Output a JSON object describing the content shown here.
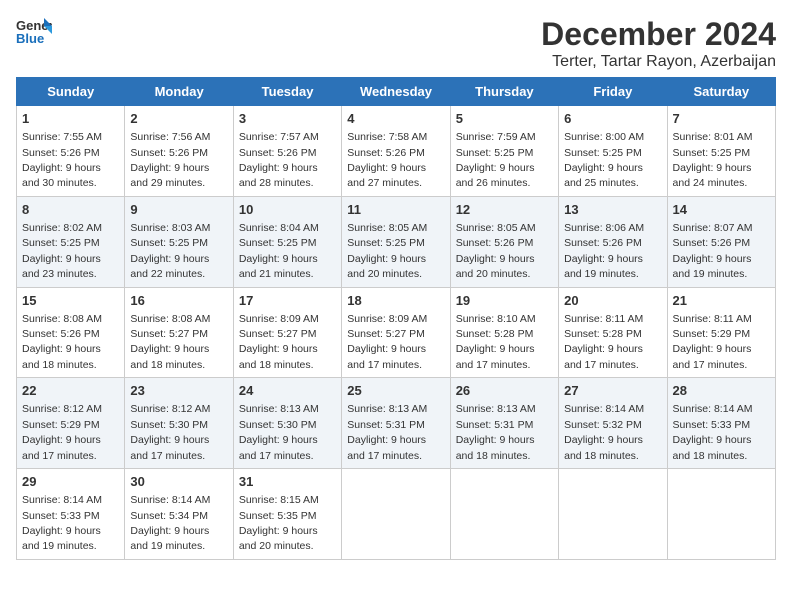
{
  "header": {
    "logo_line1": "General",
    "logo_line2": "Blue",
    "main_title": "December 2024",
    "subtitle": "Terter, Tartar Rayon, Azerbaijan"
  },
  "weekdays": [
    "Sunday",
    "Monday",
    "Tuesday",
    "Wednesday",
    "Thursday",
    "Friday",
    "Saturday"
  ],
  "weeks": [
    [
      {
        "day": "1",
        "info": "Sunrise: 7:55 AM\nSunset: 5:26 PM\nDaylight: 9 hours\nand 30 minutes."
      },
      {
        "day": "2",
        "info": "Sunrise: 7:56 AM\nSunset: 5:26 PM\nDaylight: 9 hours\nand 29 minutes."
      },
      {
        "day": "3",
        "info": "Sunrise: 7:57 AM\nSunset: 5:26 PM\nDaylight: 9 hours\nand 28 minutes."
      },
      {
        "day": "4",
        "info": "Sunrise: 7:58 AM\nSunset: 5:26 PM\nDaylight: 9 hours\nand 27 minutes."
      },
      {
        "day": "5",
        "info": "Sunrise: 7:59 AM\nSunset: 5:25 PM\nDaylight: 9 hours\nand 26 minutes."
      },
      {
        "day": "6",
        "info": "Sunrise: 8:00 AM\nSunset: 5:25 PM\nDaylight: 9 hours\nand 25 minutes."
      },
      {
        "day": "7",
        "info": "Sunrise: 8:01 AM\nSunset: 5:25 PM\nDaylight: 9 hours\nand 24 minutes."
      }
    ],
    [
      {
        "day": "8",
        "info": "Sunrise: 8:02 AM\nSunset: 5:25 PM\nDaylight: 9 hours\nand 23 minutes."
      },
      {
        "day": "9",
        "info": "Sunrise: 8:03 AM\nSunset: 5:25 PM\nDaylight: 9 hours\nand 22 minutes."
      },
      {
        "day": "10",
        "info": "Sunrise: 8:04 AM\nSunset: 5:25 PM\nDaylight: 9 hours\nand 21 minutes."
      },
      {
        "day": "11",
        "info": "Sunrise: 8:05 AM\nSunset: 5:25 PM\nDaylight: 9 hours\nand 20 minutes."
      },
      {
        "day": "12",
        "info": "Sunrise: 8:05 AM\nSunset: 5:26 PM\nDaylight: 9 hours\nand 20 minutes."
      },
      {
        "day": "13",
        "info": "Sunrise: 8:06 AM\nSunset: 5:26 PM\nDaylight: 9 hours\nand 19 minutes."
      },
      {
        "day": "14",
        "info": "Sunrise: 8:07 AM\nSunset: 5:26 PM\nDaylight: 9 hours\nand 19 minutes."
      }
    ],
    [
      {
        "day": "15",
        "info": "Sunrise: 8:08 AM\nSunset: 5:26 PM\nDaylight: 9 hours\nand 18 minutes."
      },
      {
        "day": "16",
        "info": "Sunrise: 8:08 AM\nSunset: 5:27 PM\nDaylight: 9 hours\nand 18 minutes."
      },
      {
        "day": "17",
        "info": "Sunrise: 8:09 AM\nSunset: 5:27 PM\nDaylight: 9 hours\nand 18 minutes."
      },
      {
        "day": "18",
        "info": "Sunrise: 8:09 AM\nSunset: 5:27 PM\nDaylight: 9 hours\nand 17 minutes."
      },
      {
        "day": "19",
        "info": "Sunrise: 8:10 AM\nSunset: 5:28 PM\nDaylight: 9 hours\nand 17 minutes."
      },
      {
        "day": "20",
        "info": "Sunrise: 8:11 AM\nSunset: 5:28 PM\nDaylight: 9 hours\nand 17 minutes."
      },
      {
        "day": "21",
        "info": "Sunrise: 8:11 AM\nSunset: 5:29 PM\nDaylight: 9 hours\nand 17 minutes."
      }
    ],
    [
      {
        "day": "22",
        "info": "Sunrise: 8:12 AM\nSunset: 5:29 PM\nDaylight: 9 hours\nand 17 minutes."
      },
      {
        "day": "23",
        "info": "Sunrise: 8:12 AM\nSunset: 5:30 PM\nDaylight: 9 hours\nand 17 minutes."
      },
      {
        "day": "24",
        "info": "Sunrise: 8:13 AM\nSunset: 5:30 PM\nDaylight: 9 hours\nand 17 minutes."
      },
      {
        "day": "25",
        "info": "Sunrise: 8:13 AM\nSunset: 5:31 PM\nDaylight: 9 hours\nand 17 minutes."
      },
      {
        "day": "26",
        "info": "Sunrise: 8:13 AM\nSunset: 5:31 PM\nDaylight: 9 hours\nand 18 minutes."
      },
      {
        "day": "27",
        "info": "Sunrise: 8:14 AM\nSunset: 5:32 PM\nDaylight: 9 hours\nand 18 minutes."
      },
      {
        "day": "28",
        "info": "Sunrise: 8:14 AM\nSunset: 5:33 PM\nDaylight: 9 hours\nand 18 minutes."
      }
    ],
    [
      {
        "day": "29",
        "info": "Sunrise: 8:14 AM\nSunset: 5:33 PM\nDaylight: 9 hours\nand 19 minutes."
      },
      {
        "day": "30",
        "info": "Sunrise: 8:14 AM\nSunset: 5:34 PM\nDaylight: 9 hours\nand 19 minutes."
      },
      {
        "day": "31",
        "info": "Sunrise: 8:15 AM\nSunset: 5:35 PM\nDaylight: 9 hours\nand 20 minutes."
      },
      null,
      null,
      null,
      null
    ]
  ]
}
